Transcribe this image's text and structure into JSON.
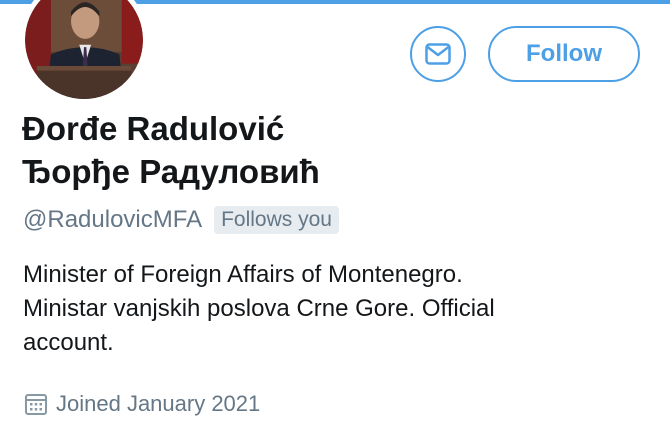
{
  "profile": {
    "name_latin": "Đorđe Radulović",
    "name_cyrillic": "Ђорђе Радуловић",
    "handle": "@RadulovicMFA",
    "follows_you_badge": "Follows you",
    "bio_lines": [
      "Minister of Foreign Affairs of Montenegro.",
      "Ministar vanjskih poslova Crne Gore. Official",
      "account."
    ],
    "joined": "Joined January 2021"
  },
  "actions": {
    "follow_label": "Follow",
    "message_icon": "envelope-icon"
  },
  "icons": {
    "joined_icon": "calendar-icon"
  },
  "colors": {
    "accent": "#4d9fe6",
    "text_primary": "#14171a",
    "text_secondary": "#657786",
    "badge_bg": "#e6ecf0"
  }
}
